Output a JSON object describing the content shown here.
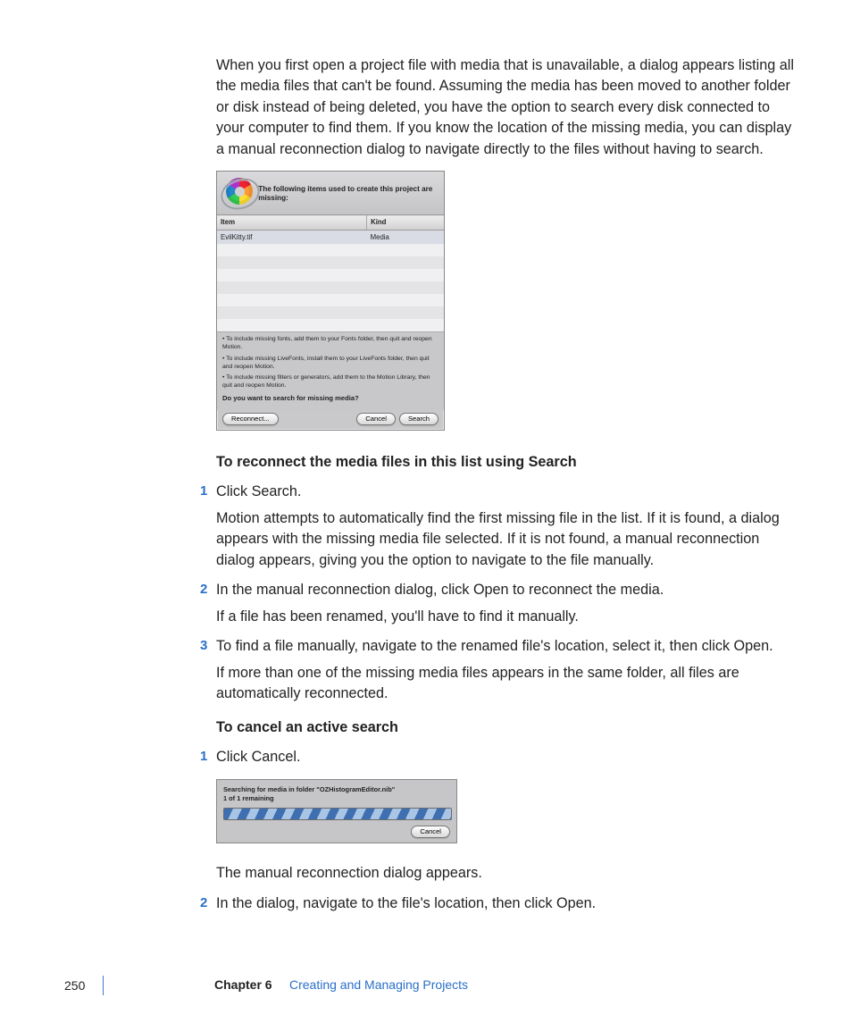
{
  "intro": "When you first open a project file with media that is unavailable, a dialog appears listing all the media files that can't be found. Assuming the media has been moved to another folder or disk instead of being deleted, you have the option to search every disk connected to your computer to find them. If you know the location of the missing media, you can display a manual reconnection dialog to navigate directly to the files without having to search.",
  "dialog1": {
    "message": "The following items used to create this project are missing:",
    "cols": {
      "item": "Item",
      "kind": "Kind"
    },
    "row": {
      "item": "EvilKitty.tif",
      "kind": "Media"
    },
    "note1": "• To include missing fonts, add them to your Fonts folder, then quit and reopen Motion.",
    "note2": "• To include missing LiveFonts, install them to your LiveFonts folder, then quit and reopen Motion.",
    "note3": "• To include missing filters or generators, add them to the Motion Library, then quit and reopen Motion.",
    "question": "Do you want to search for missing media?",
    "btn_reconnect": "Reconnect...",
    "btn_cancel": "Cancel",
    "btn_search": "Search"
  },
  "heading1": "To reconnect the media files in this list using Search",
  "steps1": {
    "s1": "Click Search.",
    "s1b": "Motion attempts to automatically find the first missing file in the list. If it is found, a dialog appears with the missing media file selected. If it is not found, a manual reconnection dialog appears, giving you the option to navigate to the file manually.",
    "s2": "In the manual reconnection dialog, click Open to reconnect the media.",
    "s2b": "If a file has been renamed, you'll have to find it manually.",
    "s3": "To find a file manually, navigate to the renamed file's location, select it, then click Open.",
    "s3b": "If more than one of the missing media files appears in the same folder, all files are automatically reconnected."
  },
  "heading2": "To cancel an active search",
  "steps2": {
    "s1": "Click Cancel."
  },
  "dialog2": {
    "line1": "Searching for media in folder \"OZHistogramEditor.nib\"",
    "line2": "1 of 1 remaining",
    "btn_cancel": "Cancel"
  },
  "after": {
    "p": "The manual reconnection dialog appears.",
    "s2": "In the dialog, navigate to the file's location, then click Open."
  },
  "footer": {
    "page": "250",
    "chapter": "Chapter 6",
    "title": "Creating and Managing Projects"
  }
}
